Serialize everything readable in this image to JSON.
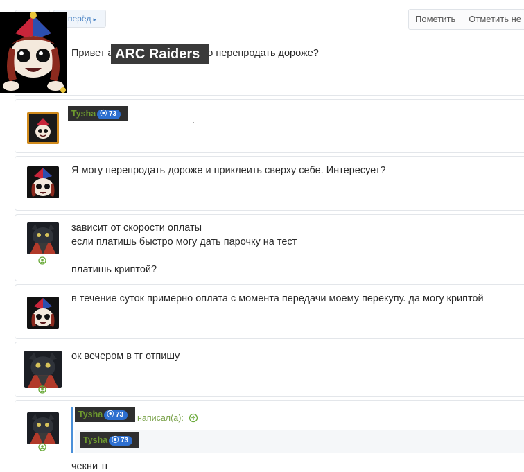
{
  "toolbar": {
    "next_label": "перёд",
    "mark_label": "Пометить",
    "mark_unread_label": "Отметить не"
  },
  "first_message": {
    "text": "Привет а                     покупаешь их можно перепродать дороже?",
    "overlay_label": "ARC Raiders"
  },
  "messages": [
    {
      "author_tag": "Tysha",
      "author_badge": "73",
      "text": "."
    },
    {
      "text": "Я могу перепродать дороже и приклеить сверху себе. Интересует?"
    },
    {
      "lines": [
        "зависит от скорости оплаты",
        "если платишь быстро могу дать парочку на тест",
        "",
        "платишь криптой?"
      ]
    },
    {
      "text": "в течение суток примерно оплата с момента передачи моему перекупу. да могу криптой"
    },
    {
      "text": "ок вечером в тг отпишу"
    },
    {
      "quote_author": "Tysha",
      "quote_badge": "73",
      "quote_wrote": "написал(а):",
      "quote_inner_author": "Tysha",
      "quote_inner_badge": "73",
      "text": "чекни тг"
    }
  ],
  "colors": {
    "accent_blue": "#4a90d9",
    "username_green": "#6e9a2e",
    "badge_blue": "#2d6fd0",
    "border": "#e3e6ea"
  }
}
